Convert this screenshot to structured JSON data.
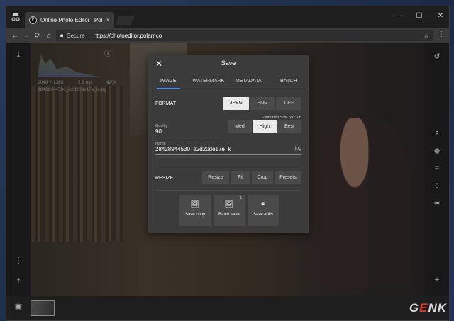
{
  "browser": {
    "tab_title": "Online Photo Editor | Pol",
    "tab_close": "×",
    "secure_label": "Secure",
    "url": "https://photoeditor.polarr.co",
    "window_controls": [
      "—",
      "☐",
      "✕"
    ]
  },
  "editor": {
    "histogram_info": {
      "dimensions": "2048 × 1365",
      "megapixels": "2.8 mp",
      "zoom": "42%",
      "filename": "28428944530_e2d20de17e_k.jpg"
    },
    "left_icons": [
      "download-icon",
      "more-icon",
      "upload-icon"
    ],
    "right_icons": [
      "history-icon",
      "filters-icon",
      "settings-icon",
      "crop-icon",
      "retouch-icon",
      "layers-icon",
      "add-icon"
    ]
  },
  "dialog": {
    "title": "Save",
    "close_glyph": "✕",
    "tabs": [
      "IMAGE",
      "WATERMARK",
      "METADATA",
      "BATCH"
    ],
    "active_tab": "IMAGE",
    "format": {
      "label": "FORMAT",
      "options": [
        "JPEG",
        "PNG",
        "TIFF"
      ],
      "selected": "JPEG",
      "estimated_size": "Estimated Size 592 KB"
    },
    "quality": {
      "label": "Quality",
      "value": "90",
      "options": [
        "Med",
        "High",
        "Best"
      ],
      "selected": "High"
    },
    "name": {
      "label": "Name",
      "value": "28428944530_e2d20de17e_k",
      "extension": ".jpg"
    },
    "resize": {
      "label": "RESIZE",
      "options": [
        "Resize",
        "Fit",
        "Crop",
        "Presets"
      ]
    },
    "actions": [
      {
        "label": "Save copy",
        "icon": "image-copy-icon"
      },
      {
        "label": "Batch save",
        "icon": "image-batch-icon",
        "badge": "1"
      },
      {
        "label": "Save edits",
        "icon": "filters-icon"
      }
    ]
  },
  "watermark": {
    "text": "GENK"
  }
}
